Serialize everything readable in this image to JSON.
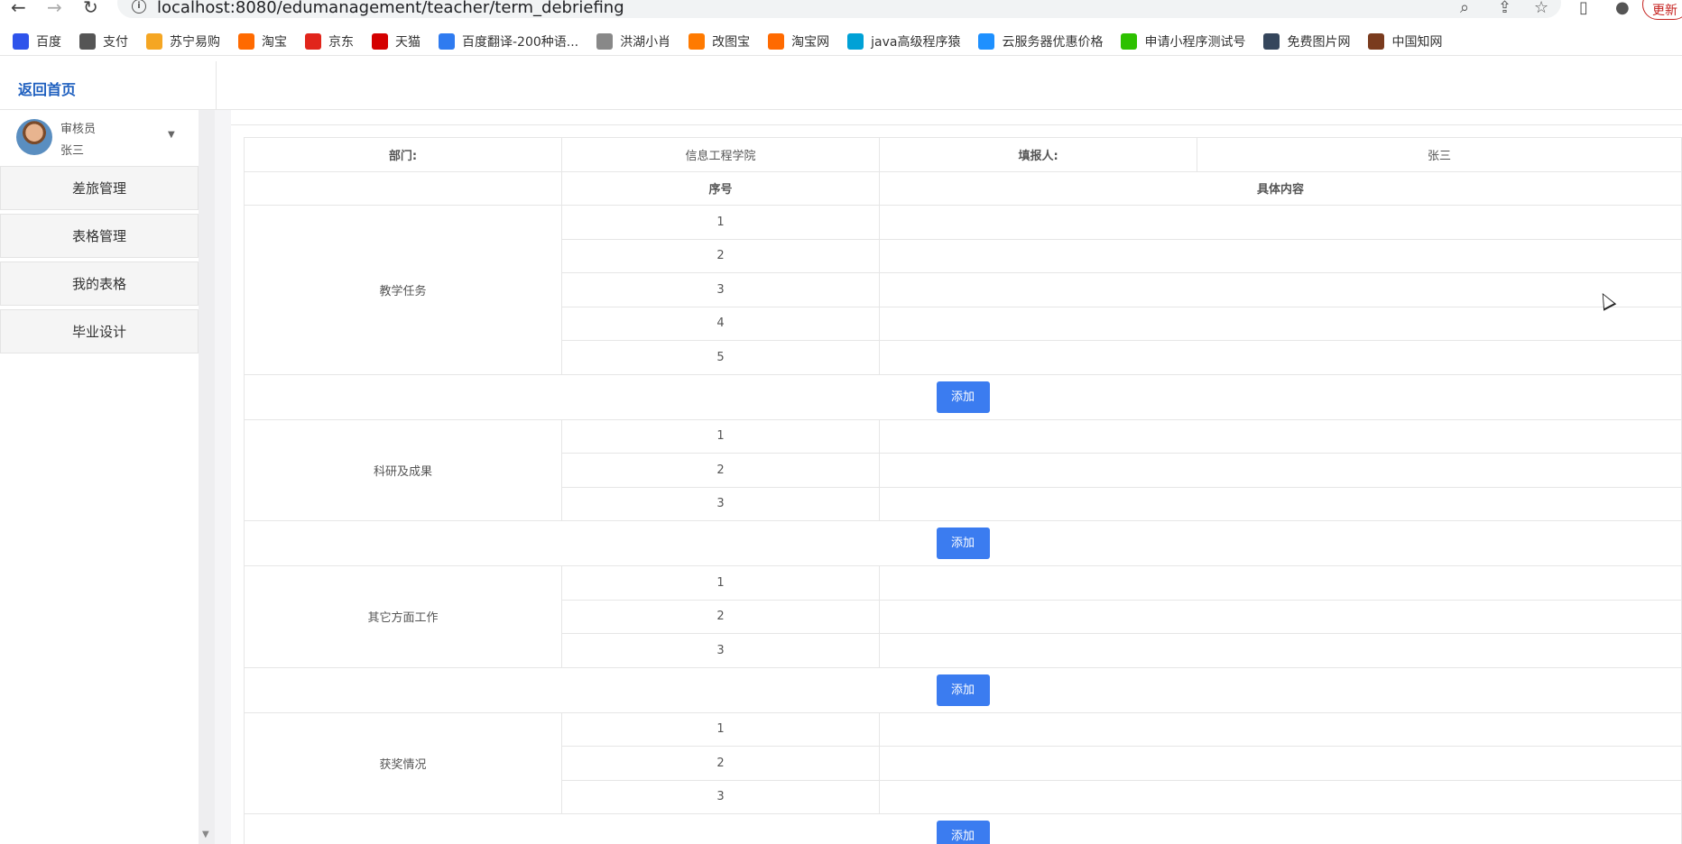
{
  "browser": {
    "url": "localhost:8080/edumanagement/teacher/term_debriefing",
    "update_label": "更新",
    "bookmarks": [
      {
        "label": "百度",
        "icon": "baidu-icon",
        "color": "#2f54eb"
      },
      {
        "label": "支付",
        "icon": "globe-icon",
        "color": "#555555"
      },
      {
        "label": "苏宁易购",
        "icon": "suning-icon",
        "color": "#f5a623"
      },
      {
        "label": "淘宝",
        "icon": "taobao-icon",
        "color": "#ff6a00"
      },
      {
        "label": "京东",
        "icon": "jd-icon",
        "color": "#e1251b"
      },
      {
        "label": "天猫",
        "icon": "tmall-icon",
        "color": "#d40000"
      },
      {
        "label": "百度翻译-200种语...",
        "icon": "translate-icon",
        "color": "#2f7bf0"
      },
      {
        "label": "洪湖小肖",
        "icon": "bird-icon",
        "color": "#888888"
      },
      {
        "label": "改图宝",
        "icon": "gaitubao-icon",
        "color": "#ff7a00"
      },
      {
        "label": "淘宝网",
        "icon": "taobao-icon",
        "color": "#ff6a00"
      },
      {
        "label": "java高级程序猿",
        "icon": "bilibili-icon",
        "color": "#00a1d6"
      },
      {
        "label": "云服务器优惠价格",
        "icon": "cloud-icon",
        "color": "#1e90ff"
      },
      {
        "label": "申请小程序测试号",
        "icon": "wechat-icon",
        "color": "#2dc100"
      },
      {
        "label": "免费图片网",
        "icon": "tumblr-icon",
        "color": "#35465c"
      },
      {
        "label": "中国知网",
        "icon": "cnki-icon",
        "color": "#7a3b1e"
      }
    ]
  },
  "app": {
    "home_link": "返回首页",
    "user": {
      "role": "审核员",
      "name": "张三"
    },
    "menu": [
      "差旅管理",
      "表格管理",
      "我的表格",
      "毕业设计"
    ]
  },
  "form": {
    "dept_label": "部门:",
    "dept_value": "信息工程学院",
    "filler_label": "填报人:",
    "filler_value": "张三",
    "seq_header": "序号",
    "content_header": "具体内容",
    "add_label": "添加",
    "sections": [
      {
        "name": "教学任务",
        "rows": [
          "1",
          "2",
          "3",
          "4",
          "5"
        ]
      },
      {
        "name": "科研及成果",
        "rows": [
          "1",
          "2",
          "3"
        ]
      },
      {
        "name": "其它方面工作",
        "rows": [
          "1",
          "2",
          "3"
        ]
      },
      {
        "name": "获奖情况",
        "rows": [
          "1",
          "2",
          "3"
        ]
      }
    ]
  }
}
